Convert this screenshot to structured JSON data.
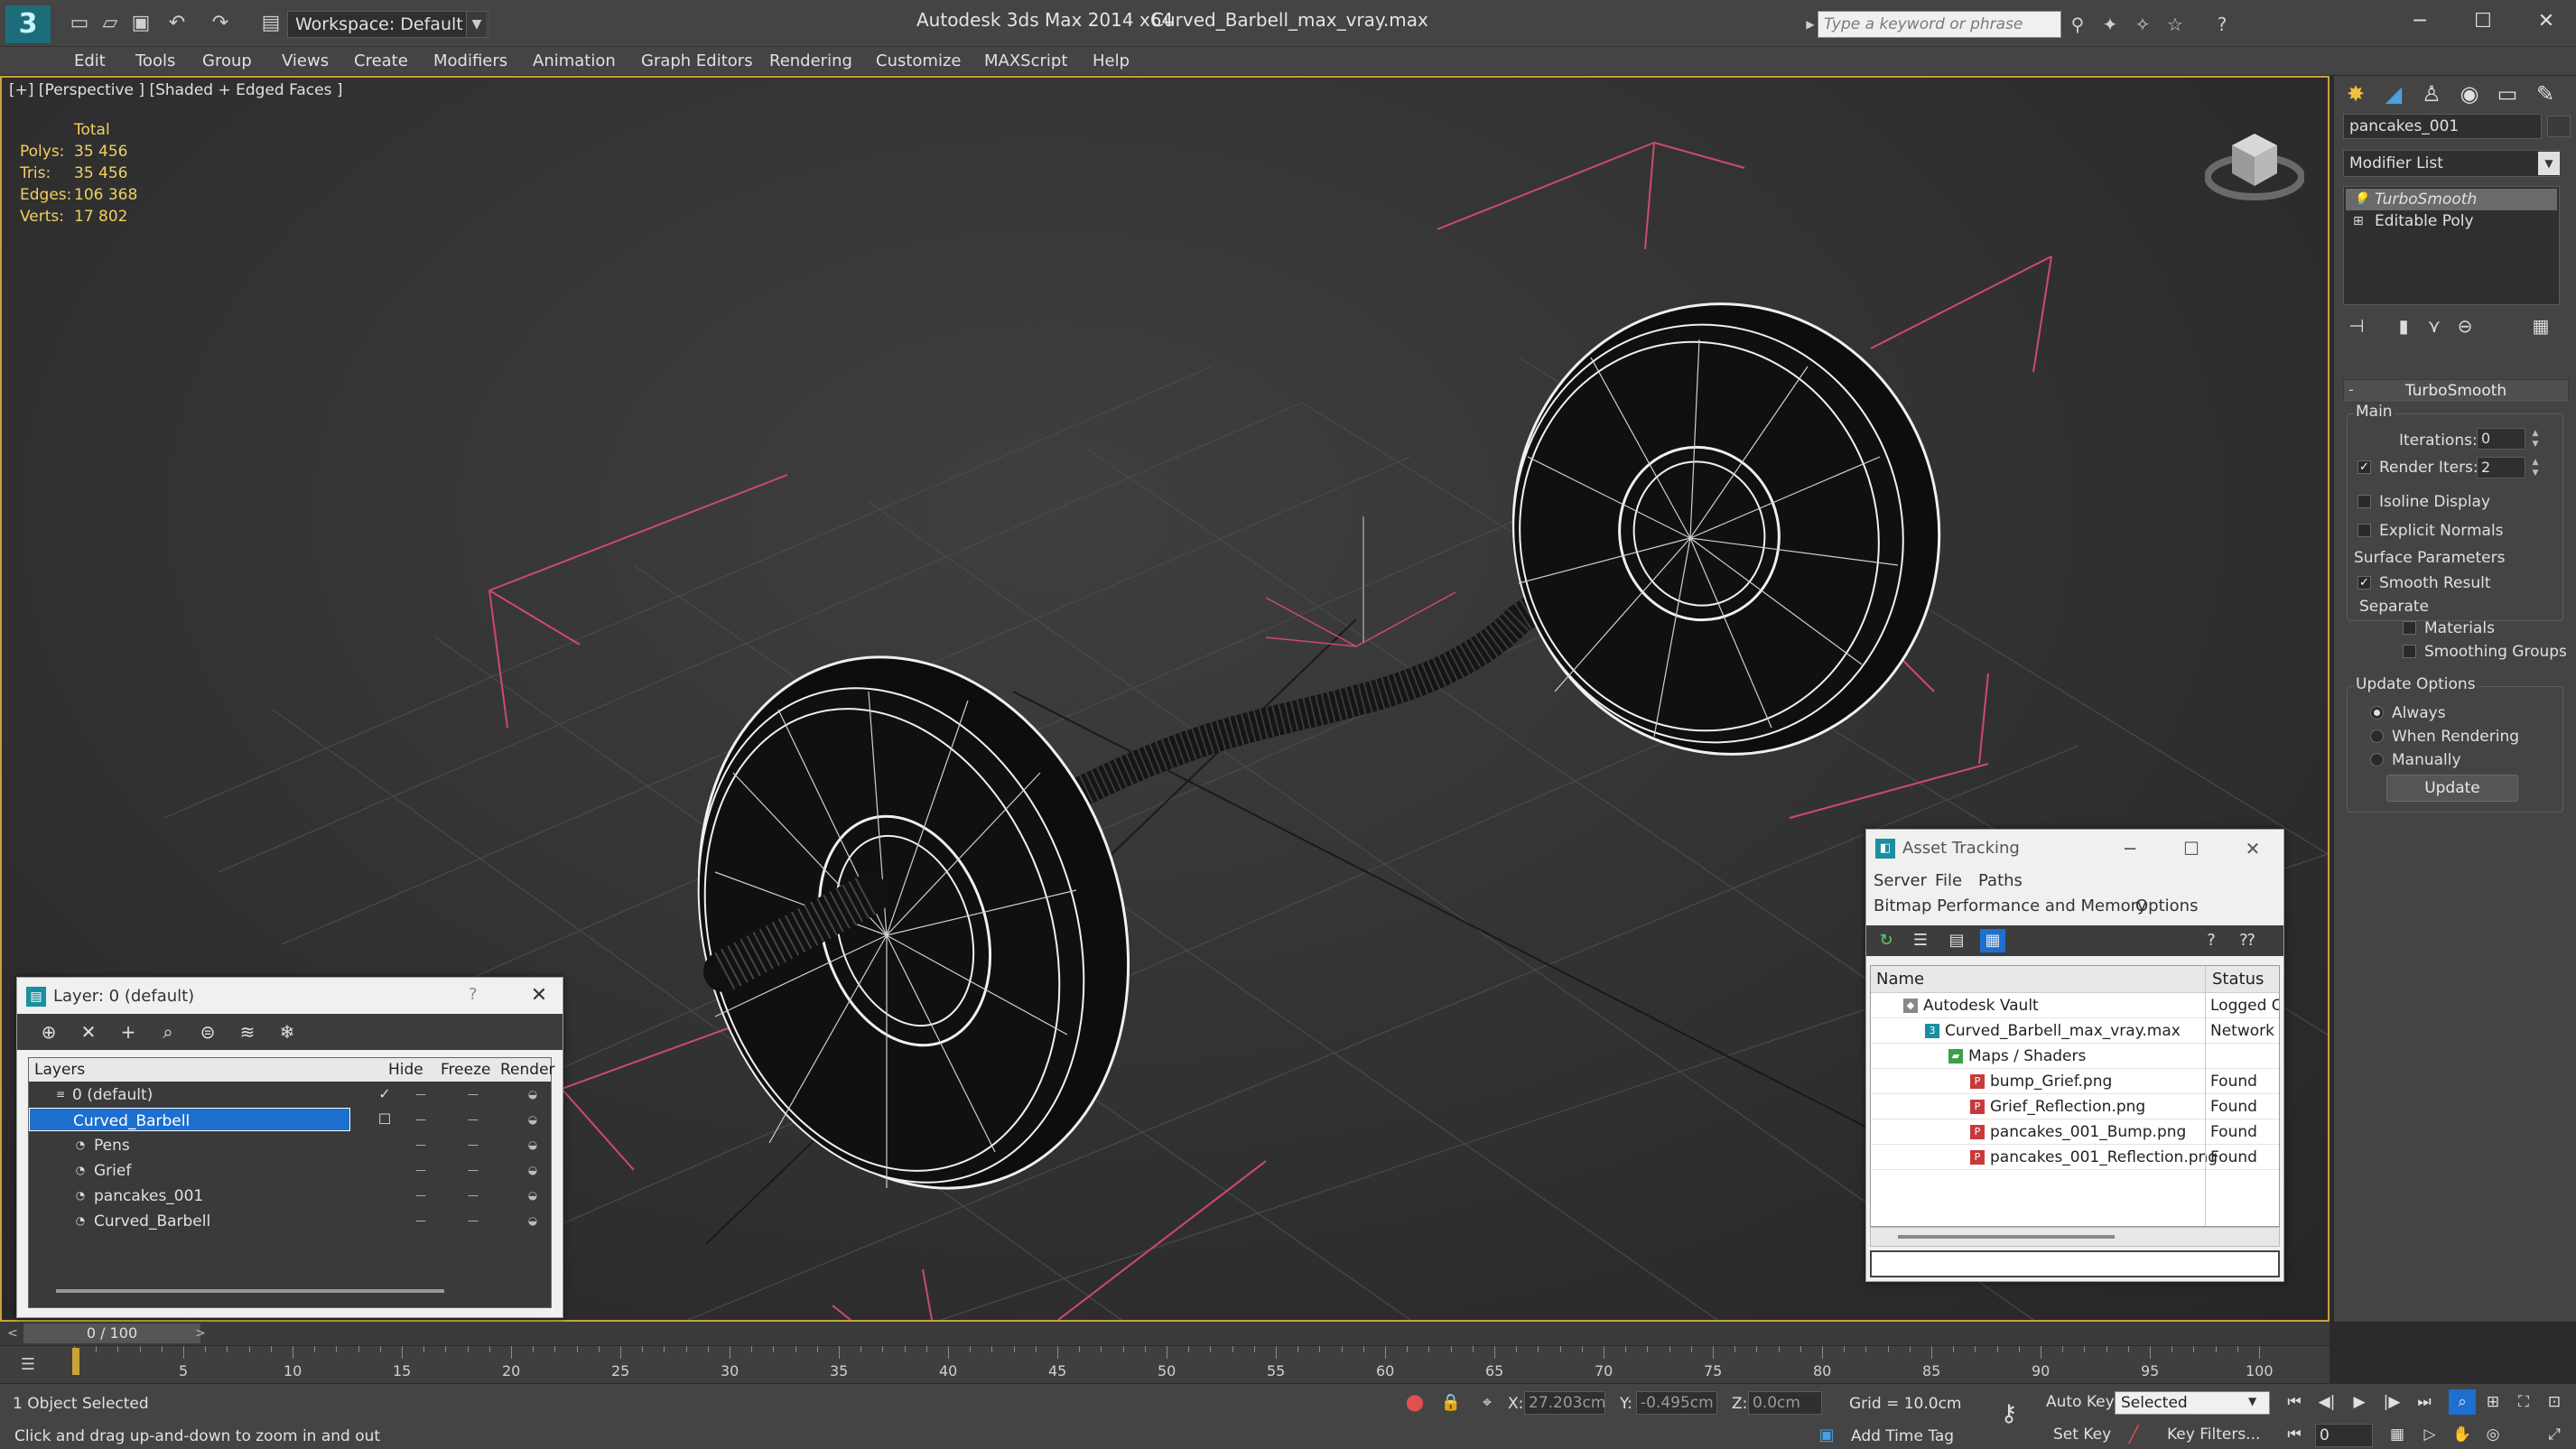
{
  "titlebar": {
    "workspace": "Workspace: Default",
    "app_title": "Autodesk 3ds Max  2014 x64",
    "file_title": "Curved_Barbell_max_vray.max",
    "search_placeholder": "Type a keyword or phrase"
  },
  "menu": [
    "Edit",
    "Tools",
    "Group",
    "Views",
    "Create",
    "Modifiers",
    "Animation",
    "Graph Editors",
    "Rendering",
    "Customize",
    "MAXScript",
    "Help"
  ],
  "viewport": {
    "label": "[+] [Perspective ] [Shaded + Edged Faces ]",
    "stats_header": "Total",
    "stats": [
      {
        "label": "Polys:",
        "value": "35 456"
      },
      {
        "label": "Tris:",
        "value": "35 456"
      },
      {
        "label": "Edges:",
        "value": "106 368"
      },
      {
        "label": "Verts:",
        "value": "17 802"
      }
    ]
  },
  "command_panel": {
    "object_name": "pancakes_001",
    "modifier_list": "Modifier List",
    "stack": [
      "TurboSmooth",
      "Editable Poly"
    ],
    "rollout_title": "TurboSmooth",
    "main_label": "Main",
    "iterations_label": "Iterations:",
    "iterations_value": "0",
    "render_iters_label": "Render Iters:",
    "render_iters_value": "2",
    "isoline_label": "Isoline Display",
    "explicit_normals_label": "Explicit Normals",
    "surface_params_label": "Surface Parameters",
    "smooth_result_label": "Smooth Result",
    "separate_label": "Separate",
    "materials_label": "Materials",
    "smoothing_groups_label": "Smoothing Groups",
    "update_options_label": "Update Options",
    "always_label": "Always",
    "when_rendering_label": "When Rendering",
    "manually_label": "Manually",
    "update_button": "Update"
  },
  "layer_dialog": {
    "title": "Layer: 0 (default)",
    "help": "?",
    "columns": {
      "layers": "Layers",
      "hide": "Hide",
      "freeze": "Freeze",
      "render": "Render"
    },
    "rows": [
      {
        "name": "0 (default)",
        "indent": 0
      },
      {
        "name": "Curved_Barbell",
        "indent": 0
      },
      {
        "name": "Pens",
        "indent": 1
      },
      {
        "name": "Grief",
        "indent": 1
      },
      {
        "name": "pancakes_001",
        "indent": 1
      },
      {
        "name": "Curved_Barbell",
        "indent": 1
      }
    ]
  },
  "asset_dialog": {
    "title": "Asset Tracking",
    "menu_row1": [
      "Server",
      "File",
      "Paths"
    ],
    "menu_row2": [
      "Bitmap Performance and Memory",
      "Options"
    ],
    "columns": {
      "name": "Name",
      "status": "Status"
    },
    "rows": [
      {
        "name": "Autodesk Vault",
        "status": "Logged O",
        "indent": 1
      },
      {
        "name": "Curved_Barbell_max_vray.max",
        "status": "Network F",
        "indent": 2
      },
      {
        "name": "Maps / Shaders",
        "status": "",
        "indent": 3
      },
      {
        "name": "bump_Grief.png",
        "status": "Found",
        "indent": 4
      },
      {
        "name": "Grief_Reflection.png",
        "status": "Found",
        "indent": 4
      },
      {
        "name": "pancakes_001_Bump.png",
        "status": "Found",
        "indent": 4
      },
      {
        "name": "pancakes_001_Reflection.png",
        "status": "Found",
        "indent": 4
      }
    ]
  },
  "timeline": {
    "slider_label": "0 / 100",
    "ticks": [
      "5",
      "10",
      "15",
      "20",
      "25",
      "30",
      "35",
      "40",
      "45",
      "50",
      "55",
      "60",
      "65",
      "70",
      "75",
      "80",
      "85",
      "90",
      "95",
      "100"
    ]
  },
  "statusbar": {
    "selection": "1 Object Selected",
    "prompt": "Click and drag up-and-down to zoom in and out",
    "x_label": "X:",
    "x_value": "27.203cm",
    "y_label": "Y:",
    "y_value": "-0.495cm",
    "z_label": "Z:",
    "z_value": "0.0cm",
    "grid": "Grid = 10.0cm",
    "add_time_tag": "Add Time Tag",
    "auto_key": "Auto Key",
    "set_key": "Set Key",
    "selected_dd": "Selected",
    "key_filters": "Key Filters...",
    "frame": "0"
  },
  "colors": {
    "accent_blue": "#1d6fd0",
    "viewport_border": "#c9a23a",
    "stats_yellow": "#f0d060",
    "gizmo_pink": "#d04a6a"
  }
}
